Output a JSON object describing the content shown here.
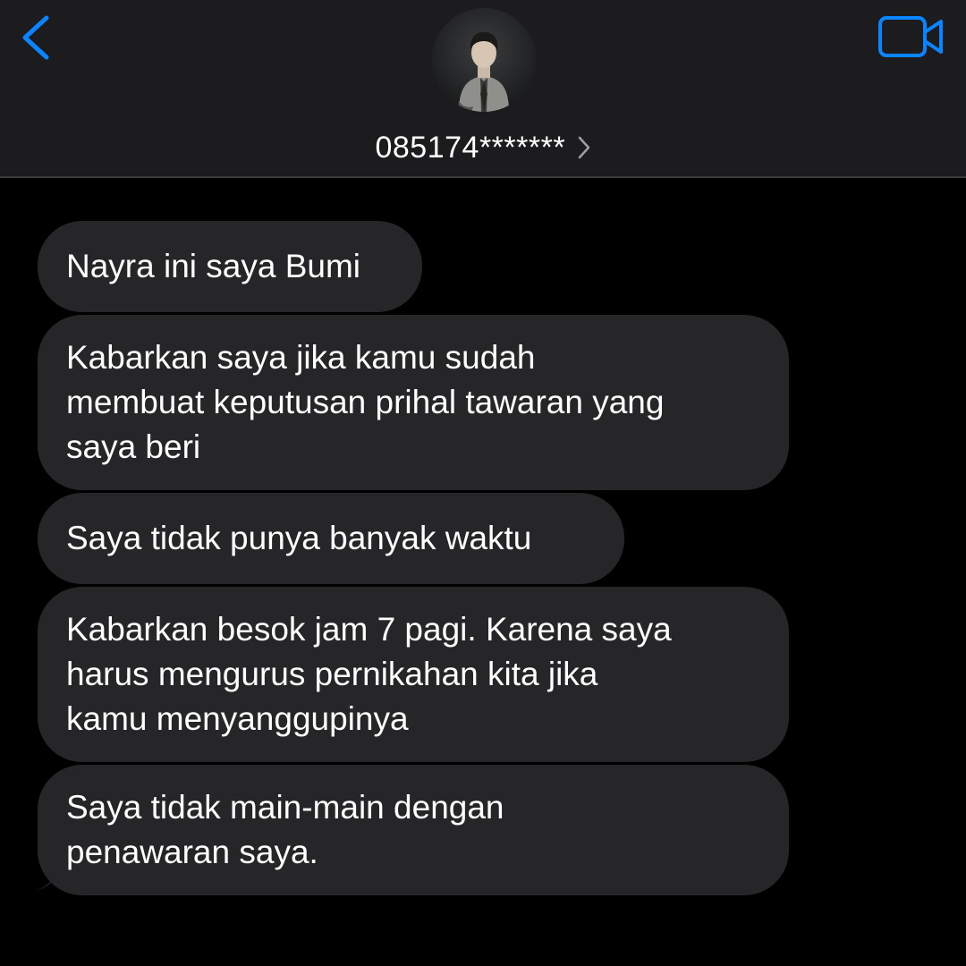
{
  "header": {
    "contact_number": "085174*******",
    "icons": {
      "back": "chevron-left-icon",
      "video": "video-camera-icon",
      "chevron": "chevron-right-icon"
    },
    "accent_color": "#0a84ff"
  },
  "messages": [
    {
      "lines": [
        "Nayra ini saya Bumi"
      ]
    },
    {
      "lines": [
        "Kabarkan saya jika kamu sudah",
        "membuat keputusan prihal tawaran yang",
        "saya beri"
      ]
    },
    {
      "lines": [
        "Saya tidak punya banyak waktu"
      ]
    },
    {
      "lines": [
        "Kabarkan besok jam 7 pagi. Karena saya",
        "harus mengurus pernikahan kita jika",
        "kamu menyanggupinya"
      ]
    },
    {
      "lines": [
        "Saya tidak main-main dengan",
        "penawaran saya."
      ]
    }
  ],
  "colors": {
    "background": "#000000",
    "header_bg": "#1c1c1e",
    "bubble_bg": "#262628",
    "text": "#ffffff"
  }
}
